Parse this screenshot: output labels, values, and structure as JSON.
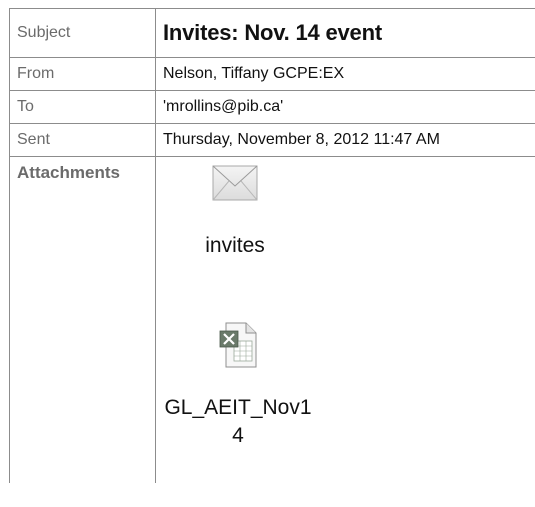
{
  "email": {
    "subject_label": "Subject",
    "subject_value": "Invites: Nov. 14 event",
    "from_label": "From",
    "from_value": "Nelson, Tiffany GCPE:EX",
    "to_label": "To",
    "to_value": "'mrollins@pib.ca'",
    "sent_label": "Sent",
    "sent_value": "Thursday, November 8, 2012 11:47 AM",
    "attachments_label": "Attachments",
    "attachments": [
      {
        "name": "invites",
        "icon": "envelope-icon"
      },
      {
        "name": "GL_AEIT_Nov14",
        "icon": "excel-file-icon"
      }
    ]
  }
}
